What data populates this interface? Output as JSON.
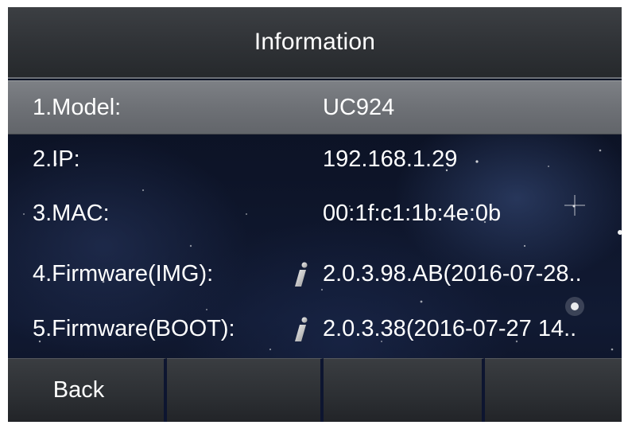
{
  "header": {
    "title": "Information"
  },
  "rows": [
    {
      "label": "1.Model:",
      "value": "UC924",
      "has_info_icon": false
    },
    {
      "label": "2.IP:",
      "value": "192.168.1.29",
      "has_info_icon": false
    },
    {
      "label": "3.MAC:",
      "value": "00:1f:c1:1b:4e:0b",
      "has_info_icon": false
    },
    {
      "label": "4.Firmware(IMG):",
      "value": "2.0.3.98.AB(2016-07-28..",
      "has_info_icon": true
    },
    {
      "label": "5.Firmware(BOOT):",
      "value": "2.0.3.38(2016-07-27 14..",
      "has_info_icon": true
    }
  ],
  "selected_row": 1,
  "softkeys": [
    {
      "label": "Back"
    },
    {
      "label": ""
    },
    {
      "label": ""
    },
    {
      "label": ""
    }
  ],
  "colors": {
    "title_bar": "#2f3236",
    "selected_row": "#6e7176",
    "text": "#ffffff",
    "background": "#0d1428"
  },
  "icons": {
    "info": "info-i-icon"
  }
}
